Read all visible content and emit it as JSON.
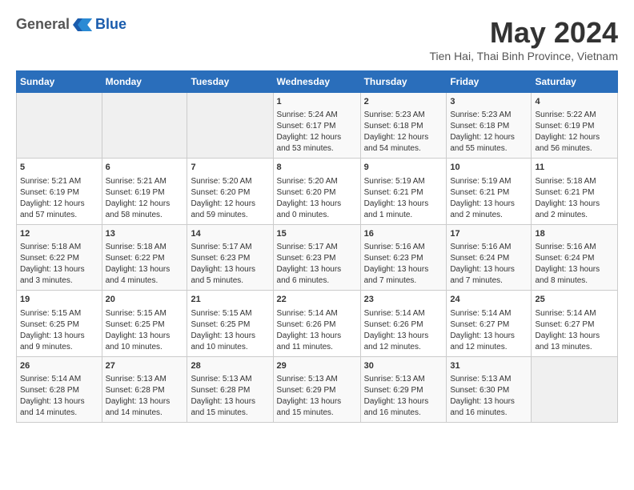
{
  "header": {
    "logo_general": "General",
    "logo_blue": "Blue",
    "month_title": "May 2024",
    "location": "Tien Hai, Thai Binh Province, Vietnam"
  },
  "weekdays": [
    "Sunday",
    "Monday",
    "Tuesday",
    "Wednesday",
    "Thursday",
    "Friday",
    "Saturday"
  ],
  "weeks": [
    [
      {
        "day": "",
        "info": ""
      },
      {
        "day": "",
        "info": ""
      },
      {
        "day": "",
        "info": ""
      },
      {
        "day": "1",
        "info": "Sunrise: 5:24 AM\nSunset: 6:17 PM\nDaylight: 12 hours\nand 53 minutes."
      },
      {
        "day": "2",
        "info": "Sunrise: 5:23 AM\nSunset: 6:18 PM\nDaylight: 12 hours\nand 54 minutes."
      },
      {
        "day": "3",
        "info": "Sunrise: 5:23 AM\nSunset: 6:18 PM\nDaylight: 12 hours\nand 55 minutes."
      },
      {
        "day": "4",
        "info": "Sunrise: 5:22 AM\nSunset: 6:19 PM\nDaylight: 12 hours\nand 56 minutes."
      }
    ],
    [
      {
        "day": "5",
        "info": "Sunrise: 5:21 AM\nSunset: 6:19 PM\nDaylight: 12 hours\nand 57 minutes."
      },
      {
        "day": "6",
        "info": "Sunrise: 5:21 AM\nSunset: 6:19 PM\nDaylight: 12 hours\nand 58 minutes."
      },
      {
        "day": "7",
        "info": "Sunrise: 5:20 AM\nSunset: 6:20 PM\nDaylight: 12 hours\nand 59 minutes."
      },
      {
        "day": "8",
        "info": "Sunrise: 5:20 AM\nSunset: 6:20 PM\nDaylight: 13 hours\nand 0 minutes."
      },
      {
        "day": "9",
        "info": "Sunrise: 5:19 AM\nSunset: 6:21 PM\nDaylight: 13 hours\nand 1 minute."
      },
      {
        "day": "10",
        "info": "Sunrise: 5:19 AM\nSunset: 6:21 PM\nDaylight: 13 hours\nand 2 minutes."
      },
      {
        "day": "11",
        "info": "Sunrise: 5:18 AM\nSunset: 6:21 PM\nDaylight: 13 hours\nand 2 minutes."
      }
    ],
    [
      {
        "day": "12",
        "info": "Sunrise: 5:18 AM\nSunset: 6:22 PM\nDaylight: 13 hours\nand 3 minutes."
      },
      {
        "day": "13",
        "info": "Sunrise: 5:18 AM\nSunset: 6:22 PM\nDaylight: 13 hours\nand 4 minutes."
      },
      {
        "day": "14",
        "info": "Sunrise: 5:17 AM\nSunset: 6:23 PM\nDaylight: 13 hours\nand 5 minutes."
      },
      {
        "day": "15",
        "info": "Sunrise: 5:17 AM\nSunset: 6:23 PM\nDaylight: 13 hours\nand 6 minutes."
      },
      {
        "day": "16",
        "info": "Sunrise: 5:16 AM\nSunset: 6:23 PM\nDaylight: 13 hours\nand 7 minutes."
      },
      {
        "day": "17",
        "info": "Sunrise: 5:16 AM\nSunset: 6:24 PM\nDaylight: 13 hours\nand 7 minutes."
      },
      {
        "day": "18",
        "info": "Sunrise: 5:16 AM\nSunset: 6:24 PM\nDaylight: 13 hours\nand 8 minutes."
      }
    ],
    [
      {
        "day": "19",
        "info": "Sunrise: 5:15 AM\nSunset: 6:25 PM\nDaylight: 13 hours\nand 9 minutes."
      },
      {
        "day": "20",
        "info": "Sunrise: 5:15 AM\nSunset: 6:25 PM\nDaylight: 13 hours\nand 10 minutes."
      },
      {
        "day": "21",
        "info": "Sunrise: 5:15 AM\nSunset: 6:25 PM\nDaylight: 13 hours\nand 10 minutes."
      },
      {
        "day": "22",
        "info": "Sunrise: 5:14 AM\nSunset: 6:26 PM\nDaylight: 13 hours\nand 11 minutes."
      },
      {
        "day": "23",
        "info": "Sunrise: 5:14 AM\nSunset: 6:26 PM\nDaylight: 13 hours\nand 12 minutes."
      },
      {
        "day": "24",
        "info": "Sunrise: 5:14 AM\nSunset: 6:27 PM\nDaylight: 13 hours\nand 12 minutes."
      },
      {
        "day": "25",
        "info": "Sunrise: 5:14 AM\nSunset: 6:27 PM\nDaylight: 13 hours\nand 13 minutes."
      }
    ],
    [
      {
        "day": "26",
        "info": "Sunrise: 5:14 AM\nSunset: 6:28 PM\nDaylight: 13 hours\nand 14 minutes."
      },
      {
        "day": "27",
        "info": "Sunrise: 5:13 AM\nSunset: 6:28 PM\nDaylight: 13 hours\nand 14 minutes."
      },
      {
        "day": "28",
        "info": "Sunrise: 5:13 AM\nSunset: 6:28 PM\nDaylight: 13 hours\nand 15 minutes."
      },
      {
        "day": "29",
        "info": "Sunrise: 5:13 AM\nSunset: 6:29 PM\nDaylight: 13 hours\nand 15 minutes."
      },
      {
        "day": "30",
        "info": "Sunrise: 5:13 AM\nSunset: 6:29 PM\nDaylight: 13 hours\nand 16 minutes."
      },
      {
        "day": "31",
        "info": "Sunrise: 5:13 AM\nSunset: 6:30 PM\nDaylight: 13 hours\nand 16 minutes."
      },
      {
        "day": "",
        "info": ""
      }
    ]
  ]
}
